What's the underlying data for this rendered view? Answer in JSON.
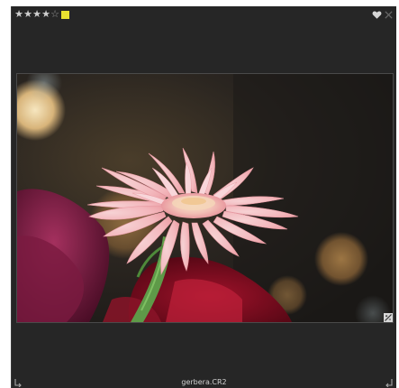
{
  "thumbnail": {
    "filename": "gerbera.CR2",
    "rating": 4,
    "max_rating": 5,
    "filled_star": "★",
    "empty_star": "☆",
    "color_label": "#e8e030",
    "flag": "heart-icon",
    "reject": "close-icon",
    "has_edits": true
  },
  "colors": {
    "cell_background": "#262626",
    "filename_text": "#d0d0d0",
    "star_filled": "#cfcfcf",
    "star_empty": "#9a9a9a"
  }
}
